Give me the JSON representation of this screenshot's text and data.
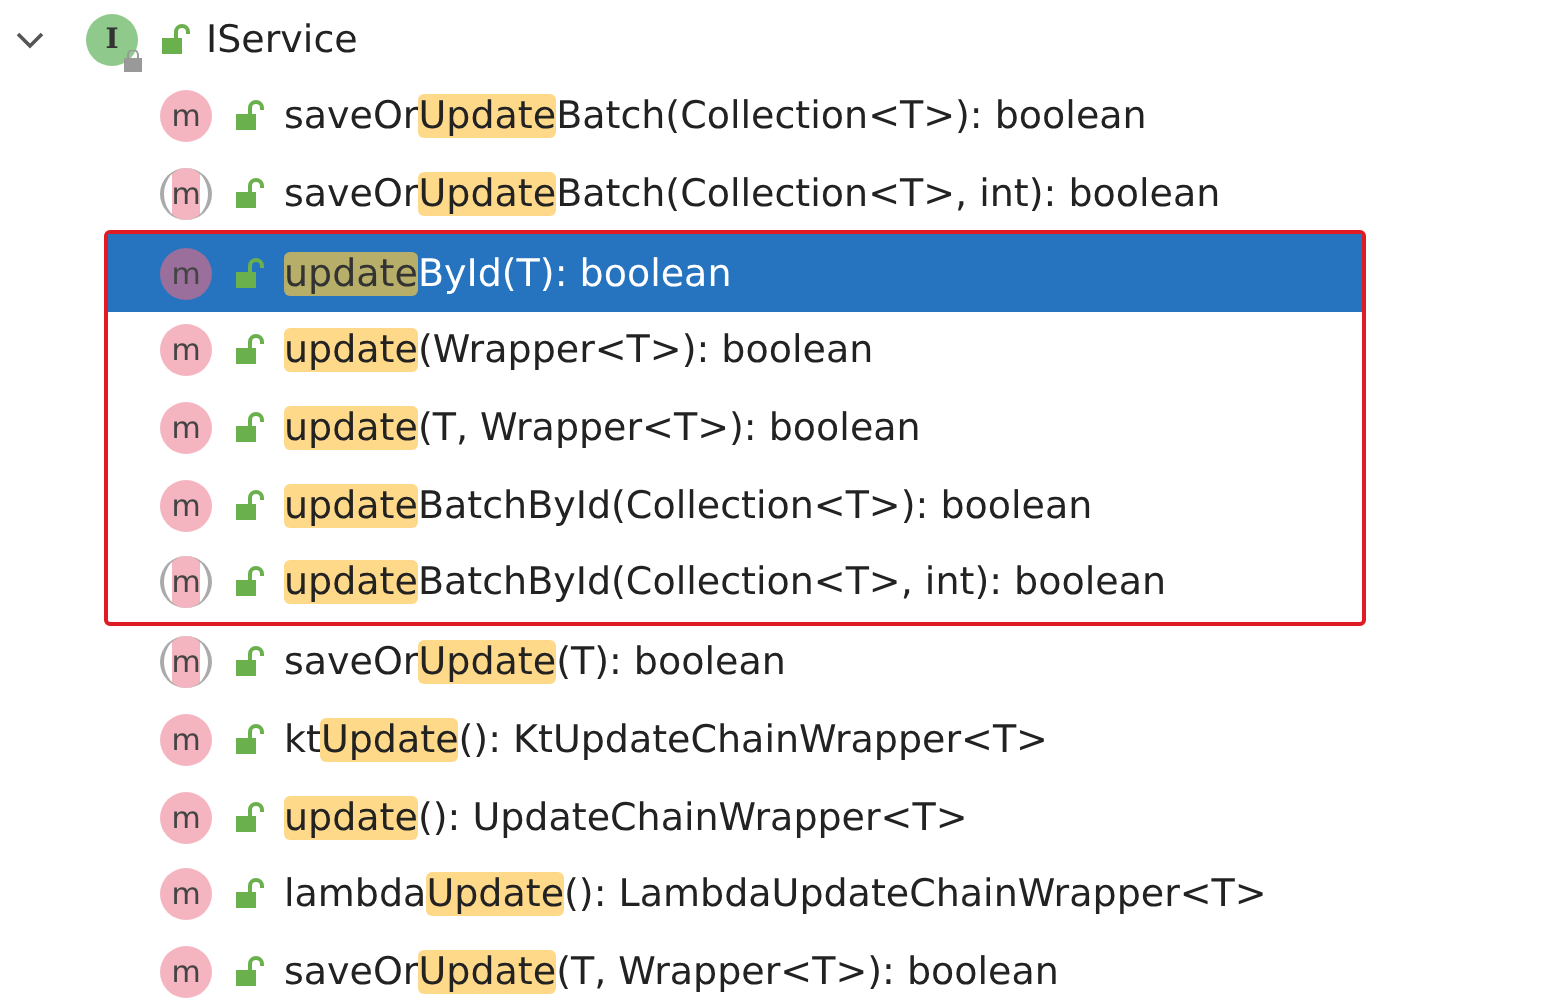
{
  "root": {
    "icon": "I",
    "label": "IService",
    "expanded": true
  },
  "rows": [
    {
      "kind": "method",
      "icon": "m",
      "selected": false,
      "boxed": false,
      "before": "saveOr",
      "match": "Update",
      "after": "Batch(Collection<T>): boolean"
    },
    {
      "kind": "default_method",
      "icon": "m",
      "selected": false,
      "boxed": false,
      "before": "saveOr",
      "match": "Update",
      "after": "Batch(Collection<T>, int): boolean"
    },
    {
      "kind": "method",
      "icon": "m",
      "selected": true,
      "boxed": true,
      "before": "",
      "match": "update",
      "after": "ById(T): boolean"
    },
    {
      "kind": "method",
      "icon": "m",
      "selected": false,
      "boxed": true,
      "before": "",
      "match": "update",
      "after": "(Wrapper<T>): boolean"
    },
    {
      "kind": "method",
      "icon": "m",
      "selected": false,
      "boxed": true,
      "before": "",
      "match": "update",
      "after": "(T, Wrapper<T>): boolean"
    },
    {
      "kind": "method",
      "icon": "m",
      "selected": false,
      "boxed": true,
      "before": "",
      "match": "update",
      "after": "BatchById(Collection<T>): boolean"
    },
    {
      "kind": "default_method",
      "icon": "m",
      "selected": false,
      "boxed": true,
      "before": "",
      "match": "update",
      "after": "BatchById(Collection<T>, int): boolean"
    },
    {
      "kind": "default_method",
      "icon": "m",
      "selected": false,
      "boxed": false,
      "before": "saveOr",
      "match": "Update",
      "after": "(T): boolean"
    },
    {
      "kind": "method",
      "icon": "m",
      "selected": false,
      "boxed": false,
      "before": "kt",
      "match": "Update",
      "after": "(): KtUpdateChainWrapper<T>"
    },
    {
      "kind": "method",
      "icon": "m",
      "selected": false,
      "boxed": false,
      "before": "",
      "match": "update",
      "after": "(): UpdateChainWrapper<T>"
    },
    {
      "kind": "method",
      "icon": "m",
      "selected": false,
      "boxed": false,
      "before": "lambda",
      "match": "Update",
      "after": "(): LambdaUpdateChainWrapper<T>"
    },
    {
      "kind": "method",
      "icon": "m",
      "selected": false,
      "boxed": false,
      "before": "saveOr",
      "match": "Update",
      "after": "(T, Wrapper<T>): boolean"
    }
  ]
}
